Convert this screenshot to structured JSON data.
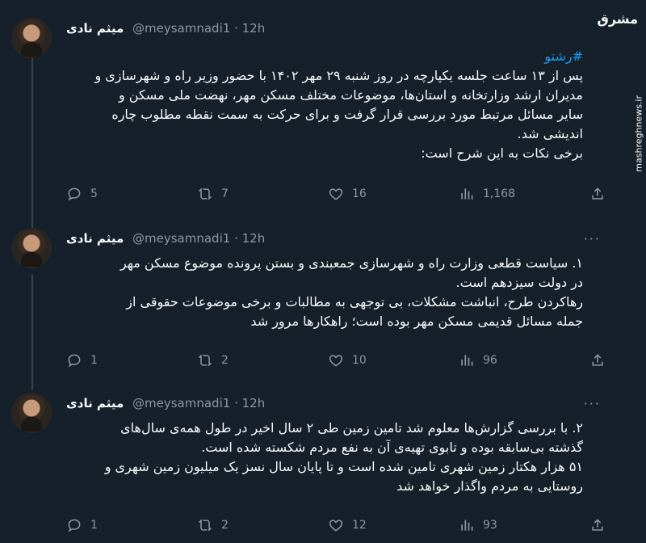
{
  "watermark": {
    "logo": "مشرق",
    "site": "mashreghnews.ir"
  },
  "tweets": [
    {
      "author": "میثم نادی",
      "handle": "@meysamnadi1",
      "time": "12h",
      "hashtag": "#رشتو",
      "lines": [
        "پس از ۱۳ ساعت جلسه یکپارچه در روز شنبه ۲۹ مهر ۱۴۰۲ با حضور وزیر راه و شهرسازی و",
        "مدیران ارشد وزارتخانه و استان‌ها، موضوعات مختلف مسکن مهر، نهضت ملی مسکن و",
        "سایر مسائل مرتبط مورد بررسی قرار گرفت و برای حرکت به سمت نقطه مطلوب چاره",
        "اندیشی شد.",
        "برخی نکات به این شرح است:"
      ],
      "replies": "5",
      "retweets": "7",
      "likes": "16",
      "views": "1,168"
    },
    {
      "author": "میثم نادی",
      "handle": "@meysamnadi1",
      "time": "12h",
      "lines": [
        "۱. سیاست قطعی وزارت راه و شهرسازی جمعبندی و بستن پرونده موضوع مسکن مهر",
        "در دولت سیزدهم است.",
        "رهاکردن طرح، انباشت مشکلات، بی توجهی به مطالبات و برخی موضوعات حقوقی از",
        "جمله مسائل قدیمی مسکن مهر بوده است؛ راهکارها مرور شد"
      ],
      "replies": "1",
      "retweets": "2",
      "likes": "10",
      "views": "96"
    },
    {
      "author": "میثم نادی",
      "handle": "@meysamnadi1",
      "time": "12h",
      "lines": [
        "۲. با بررسی گزارش‌ها معلوم شد تامین زمین طی ۲ سال اخیر در طول همه‌ی سال‌های",
        "گذشته بی‌سابقه بوده و تابوی تهیه‌ی آن به نفع مردم شکسته شده است.",
        "۵۱ هزار هکتار زمین شهری تامین شده است و تا پایان سال نسز یک میلیون زمین شهری و",
        "روستایی به مردم واگذار خواهد شد"
      ],
      "replies": "1",
      "retweets": "2",
      "likes": "12",
      "views": "93"
    }
  ]
}
